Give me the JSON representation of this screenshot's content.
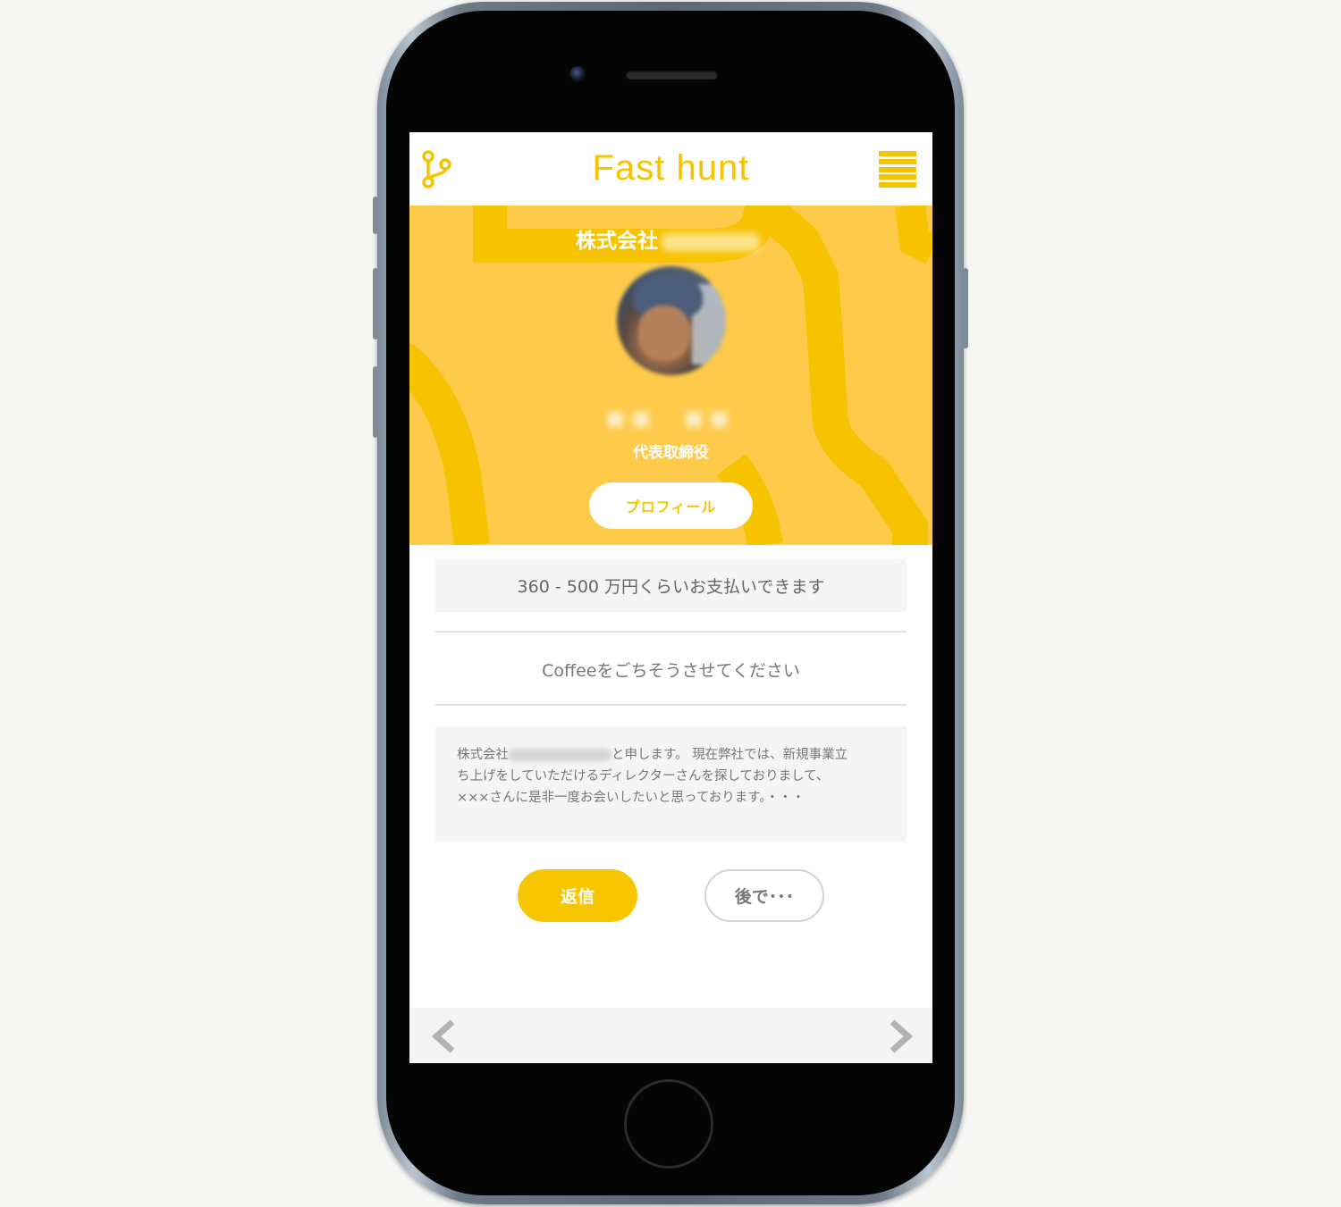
{
  "app": {
    "title": "Fast hunt",
    "accent_color": "#f5c400",
    "logo_icon": "branch-icon",
    "menu_icon": "hamburger-menu-icon"
  },
  "hero": {
    "company_label": "株式会社",
    "person_title": "代表取締役",
    "profile_button_label": "プロフィール",
    "background_color": "#fdca4a"
  },
  "offer": {
    "salary_text": "360 - 500 万円くらいお支払いできます",
    "offer_type_text": "Coffeeをごちそうさせてください"
  },
  "message": {
    "line1_prefix": "株式会社",
    "line1_suffix": "と申します。 現在弊社では、新規事業立",
    "line2": "ち上げをしていただけるディレクターさんを探しておりまして、",
    "line3": "×××さんに是非一度お会いしたいと思っております。・・・"
  },
  "actions": {
    "reply_label": "返信",
    "later_label": "後で･･･"
  },
  "nav": {
    "prev_icon": "chevron-left-icon",
    "next_icon": "chevron-right-icon"
  }
}
